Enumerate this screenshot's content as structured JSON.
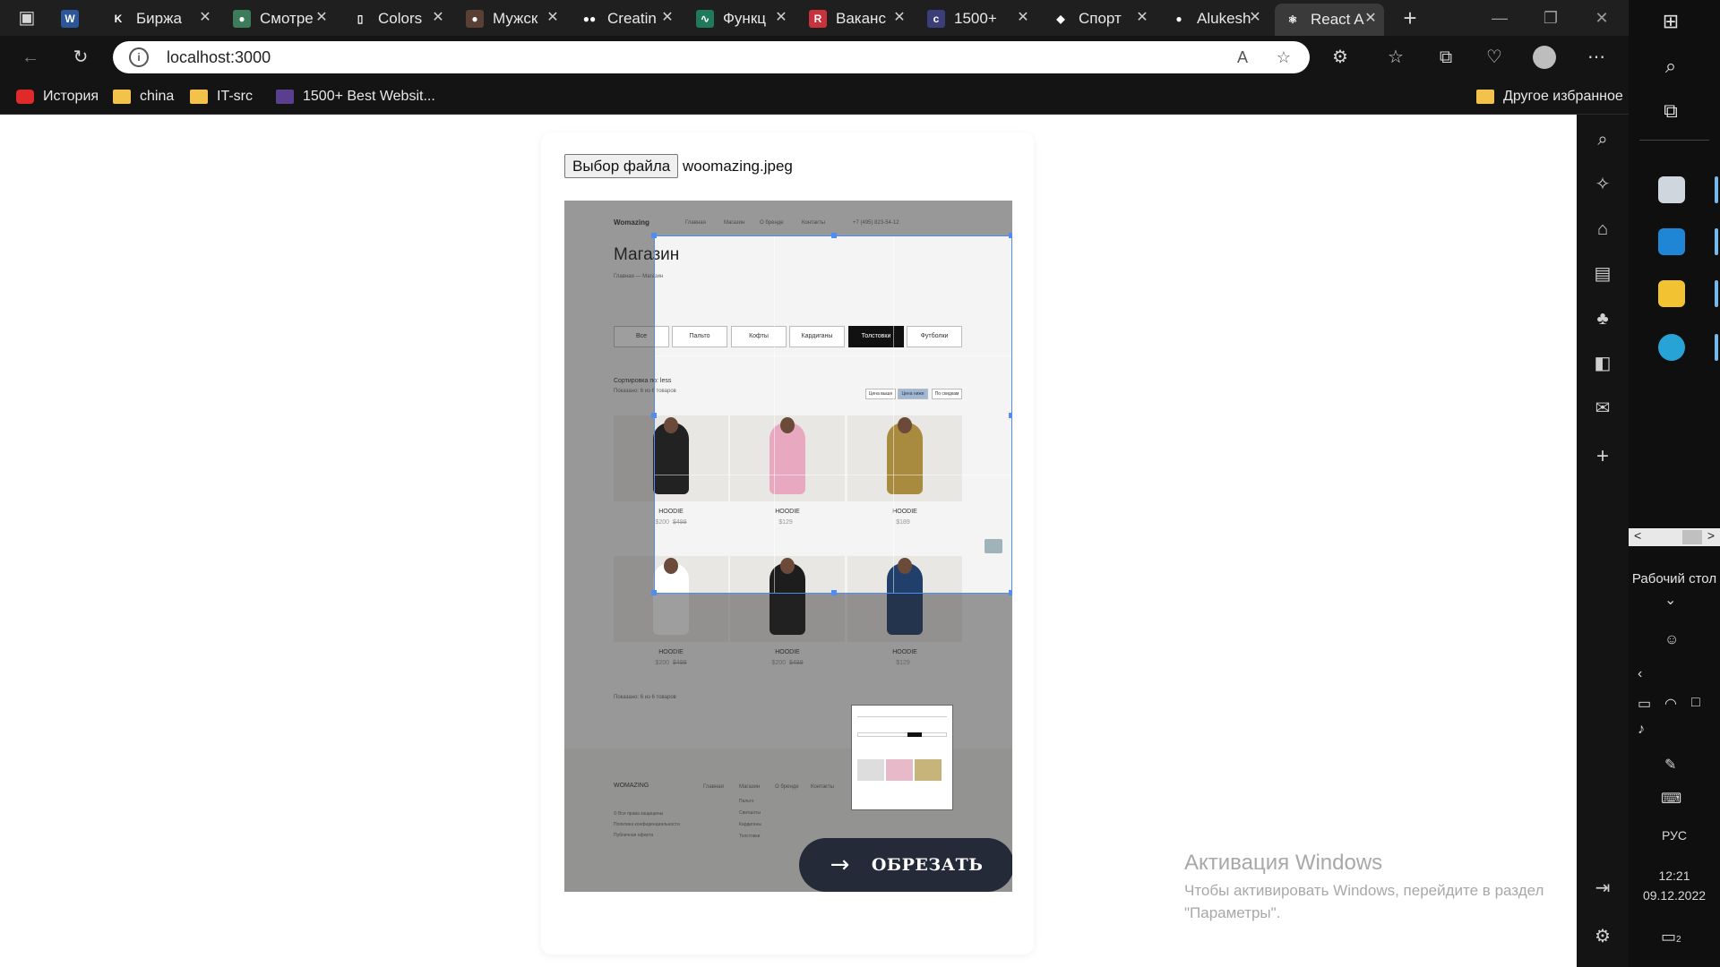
{
  "browser": {
    "tabs": [
      {
        "label": "",
        "favicon": "word-icon",
        "color": "#2b579a",
        "glyph": "W"
      },
      {
        "label": "Биржа",
        "favicon": "kwork-icon",
        "color": "#1f1f1f",
        "glyph": "K"
      },
      {
        "label": "Смотре",
        "favicon": "globe-icon",
        "color": "#3d7c5a",
        "glyph": "●"
      },
      {
        "label": "Colors",
        "favicon": "page-icon",
        "color": "#1f1f1f",
        "glyph": "▯"
      },
      {
        "label": "Мужск",
        "favicon": "site-icon",
        "color": "#5a3f35",
        "glyph": "●"
      },
      {
        "label": "Creatin",
        "favicon": "medium-icon",
        "color": "#1f1f1f",
        "glyph": "●●"
      },
      {
        "label": "Функц",
        "favicon": "chart-icon",
        "color": "#1f7a5c",
        "glyph": "∿"
      },
      {
        "label": "Ваканс",
        "favicon": "rabota-icon",
        "color": "#c8323c",
        "glyph": "R"
      },
      {
        "label": "1500+",
        "favicon": "colorlib-icon",
        "color": "#3a3f7a",
        "glyph": "c"
      },
      {
        "label": "Спорт",
        "favicon": "figma-icon",
        "color": "#1f1f1f",
        "glyph": "◆"
      },
      {
        "label": "Alukesh",
        "favicon": "github-icon",
        "color": "#1f1f1f",
        "glyph": "●"
      },
      {
        "label": "React A",
        "favicon": "react-icon",
        "color": "#3a3a3a",
        "glyph": "⚛"
      }
    ],
    "new_tab": "+",
    "address": "localhost:3000",
    "bookmarks": [
      {
        "label": "История",
        "icon": "youtube-icon"
      },
      {
        "label": "china",
        "icon": "folder-icon"
      },
      {
        "label": "IT-src",
        "icon": "folder-icon"
      },
      {
        "label": "1500+ Best Websit...",
        "icon": "colorlib-icon"
      }
    ],
    "other_favorites": "Другое избранное"
  },
  "uploader": {
    "file_button": "Выбор файла",
    "file_name": "woomazing.jpeg",
    "crop_button": "ОБРЕЗАТЬ"
  },
  "shop_image": {
    "brand": "Womazing",
    "nav": [
      "Главная",
      "Магазин",
      "О бренде",
      "Контакты"
    ],
    "phone": "+7 (495) 823-54-12",
    "heading": "Магазин",
    "breadcrumb": "Главная — Магазин",
    "filters": [
      "Все",
      "Пальто",
      "Кофты",
      "Кардиганы",
      "Толстовки",
      "Футболки"
    ],
    "active_filter": "Толстовки",
    "sort_label": "Сортировка по: less",
    "shown_text": "Показано: 6 из 6 товаров",
    "sort_buttons": [
      "Цена выше",
      "Цена ниже",
      "По скидкам"
    ],
    "products": [
      {
        "name": "HOODIE",
        "price": "$200",
        "old": "$499"
      },
      {
        "name": "HOODIE",
        "price": "$129",
        "old": ""
      },
      {
        "name": "HOODIE",
        "price": "$189",
        "old": ""
      },
      {
        "name": "HOODIE",
        "price": "$200",
        "old": "$499"
      },
      {
        "name": "HOODIE",
        "price": "$200",
        "old": "$499"
      },
      {
        "name": "HOODIE",
        "price": "$129",
        "old": ""
      }
    ],
    "footer_shown": "Показано: 6 из 6 товаров",
    "footer_brand": "WOMAZING",
    "footer_nav": [
      "Главная",
      "Магазин",
      "О бренде",
      "Контакты"
    ],
    "footer_links": [
      "© Все права защищены",
      "Политика конфиденциальности",
      "Публичная оферта"
    ],
    "footer_cats": [
      "Пальто",
      "Свитшоты",
      "Кардиганы",
      "Толстовки"
    ]
  },
  "watermark": {
    "title": "Активация Windows",
    "text": "Чтобы активировать Windows, перейдите в раздел \"Параметры\"."
  },
  "taskbar": {
    "desktop_label": "Рабочий стол",
    "lang": "РУС",
    "time": "12:21",
    "date": "09.12.2022",
    "notifications": "2"
  }
}
